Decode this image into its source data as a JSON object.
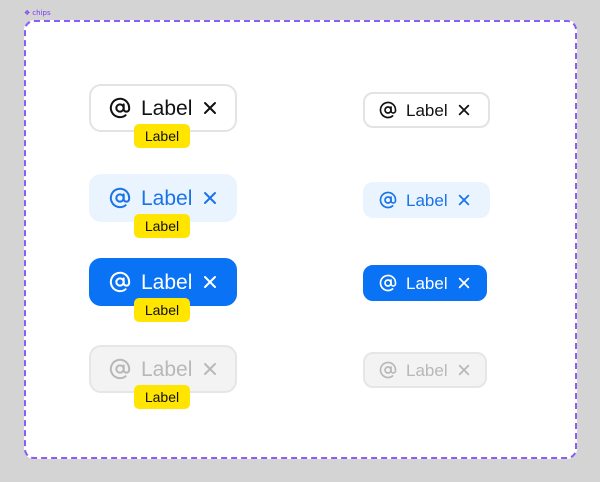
{
  "frame": {
    "name": "chips",
    "accent": "#8b5cf6"
  },
  "chips": [
    {
      "variant": "default",
      "size": "large",
      "label": "Label",
      "overlay": "Label",
      "icon": "at-sign-icon",
      "close_icon": "close-icon"
    },
    {
      "variant": "tinted",
      "size": "large",
      "label": "Label",
      "overlay": "Label",
      "icon": "at-sign-icon",
      "close_icon": "close-icon"
    },
    {
      "variant": "filled",
      "size": "large",
      "label": "Label",
      "overlay": "Label",
      "icon": "at-sign-icon",
      "close_icon": "close-icon"
    },
    {
      "variant": "disabled",
      "size": "large",
      "label": "Label",
      "overlay": "Label",
      "icon": "at-sign-icon",
      "close_icon": "close-icon"
    },
    {
      "variant": "default",
      "size": "small",
      "label": "Label",
      "icon": "at-sign-icon",
      "close_icon": "close-icon"
    },
    {
      "variant": "tinted",
      "size": "small",
      "label": "Label",
      "icon": "at-sign-icon",
      "close_icon": "close-icon"
    },
    {
      "variant": "filled",
      "size": "small",
      "label": "Label",
      "icon": "at-sign-icon",
      "close_icon": "close-icon"
    },
    {
      "variant": "disabled",
      "size": "small",
      "label": "Label",
      "icon": "at-sign-icon",
      "close_icon": "close-icon"
    }
  ],
  "colors": {
    "filled_blue": "#0a72f5",
    "tinted_bg": "#eaf4ff",
    "tinted_text": "#1a73e8",
    "badge_yellow": "#ffe500",
    "disabled_text": "#b8b8b8"
  }
}
